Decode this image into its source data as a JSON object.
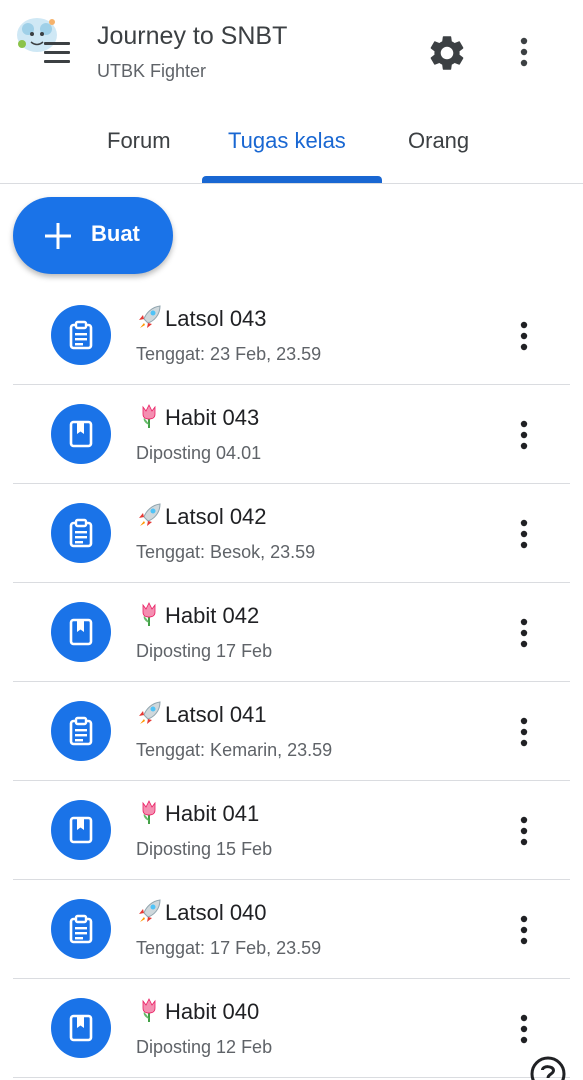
{
  "header": {
    "title": "Journey to SNBT",
    "subtitle": "UTBK Fighter",
    "icons": [
      "menu-icon",
      "class-avatar",
      "gear-icon",
      "more-vert-icon"
    ]
  },
  "tabs": [
    {
      "label": "Forum",
      "active": false
    },
    {
      "label": "Tugas kelas",
      "active": true
    },
    {
      "label": "Orang",
      "active": false
    }
  ],
  "fab": {
    "label": "Buat",
    "icon": "plus-icon"
  },
  "colors": {
    "accent": "#1a73e8",
    "active_tab": "#1967d2",
    "text_primary": "#202124",
    "text_secondary": "#5f6368",
    "divider": "#dadce0"
  },
  "items": [
    {
      "emoji": "rocket",
      "title": "Latsol 043",
      "sub": "Tenggat: 23 Feb, 23.59",
      "icon": "assignment-icon"
    },
    {
      "emoji": "tulip",
      "title": "Habit 043",
      "sub": "Diposting 04.01",
      "icon": "material-icon"
    },
    {
      "emoji": "rocket",
      "title": "Latsol 042",
      "sub": "Tenggat: Besok, 23.59",
      "icon": "assignment-icon"
    },
    {
      "emoji": "tulip",
      "title": "Habit 042",
      "sub": "Diposting 17 Feb",
      "icon": "material-icon"
    },
    {
      "emoji": "rocket",
      "title": "Latsol 041",
      "sub": "Tenggat: Kemarin, 23.59",
      "icon": "assignment-icon"
    },
    {
      "emoji": "tulip",
      "title": "Habit 041",
      "sub": "Diposting 15 Feb",
      "icon": "material-icon"
    },
    {
      "emoji": "rocket",
      "title": "Latsol 040",
      "sub": "Tenggat: 17 Feb, 23.59",
      "icon": "assignment-icon"
    },
    {
      "emoji": "tulip",
      "title": "Habit 040",
      "sub": "Diposting 12 Feb",
      "icon": "material-icon"
    }
  ]
}
